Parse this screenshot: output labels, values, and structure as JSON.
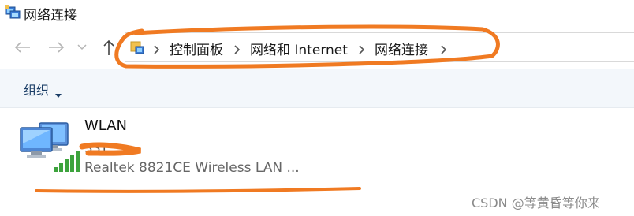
{
  "window": {
    "title": "网络连接"
  },
  "nav": {
    "back_icon": "back-arrow-icon",
    "forward_icon": "forward-arrow-icon",
    "recent_icon": "chevron-down-icon",
    "up_icon": "up-arrow-icon"
  },
  "address": {
    "icon": "control-panel-icon",
    "crumbs": [
      "控制面板",
      "网络和 Internet",
      "网络连接"
    ]
  },
  "commandbar": {
    "organize_label": "组织"
  },
  "connections": [
    {
      "name": "WLAN",
      "status": "SST",
      "description": "Realtek 8821CE Wireless LAN ..."
    }
  ],
  "watermark": "CSDN @等黄昏等你来",
  "annotation_color": "#f07a22"
}
